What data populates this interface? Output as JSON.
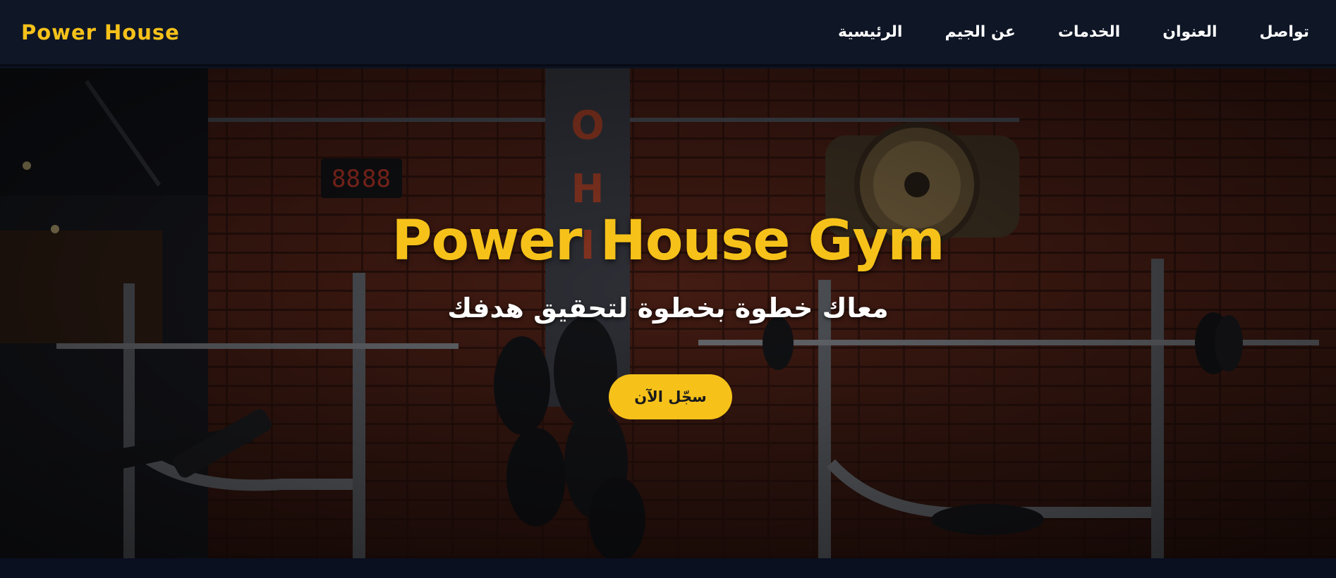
{
  "navbar": {
    "brand": "Power House",
    "links": [
      {
        "label": "تواصل"
      },
      {
        "label": "العنوان"
      },
      {
        "label": "الخدمات"
      },
      {
        "label": "عن الجيم"
      },
      {
        "label": "الرئيسية"
      }
    ]
  },
  "hero": {
    "title": "Power House Gym",
    "subtitle": "معاك خطوة بخطوة لتحقيق هدفك",
    "cta_label": "سجّل الآن"
  },
  "colors": {
    "accent": "#f6c21a",
    "nav_background": "#0f1626",
    "text": "#ffffff"
  }
}
